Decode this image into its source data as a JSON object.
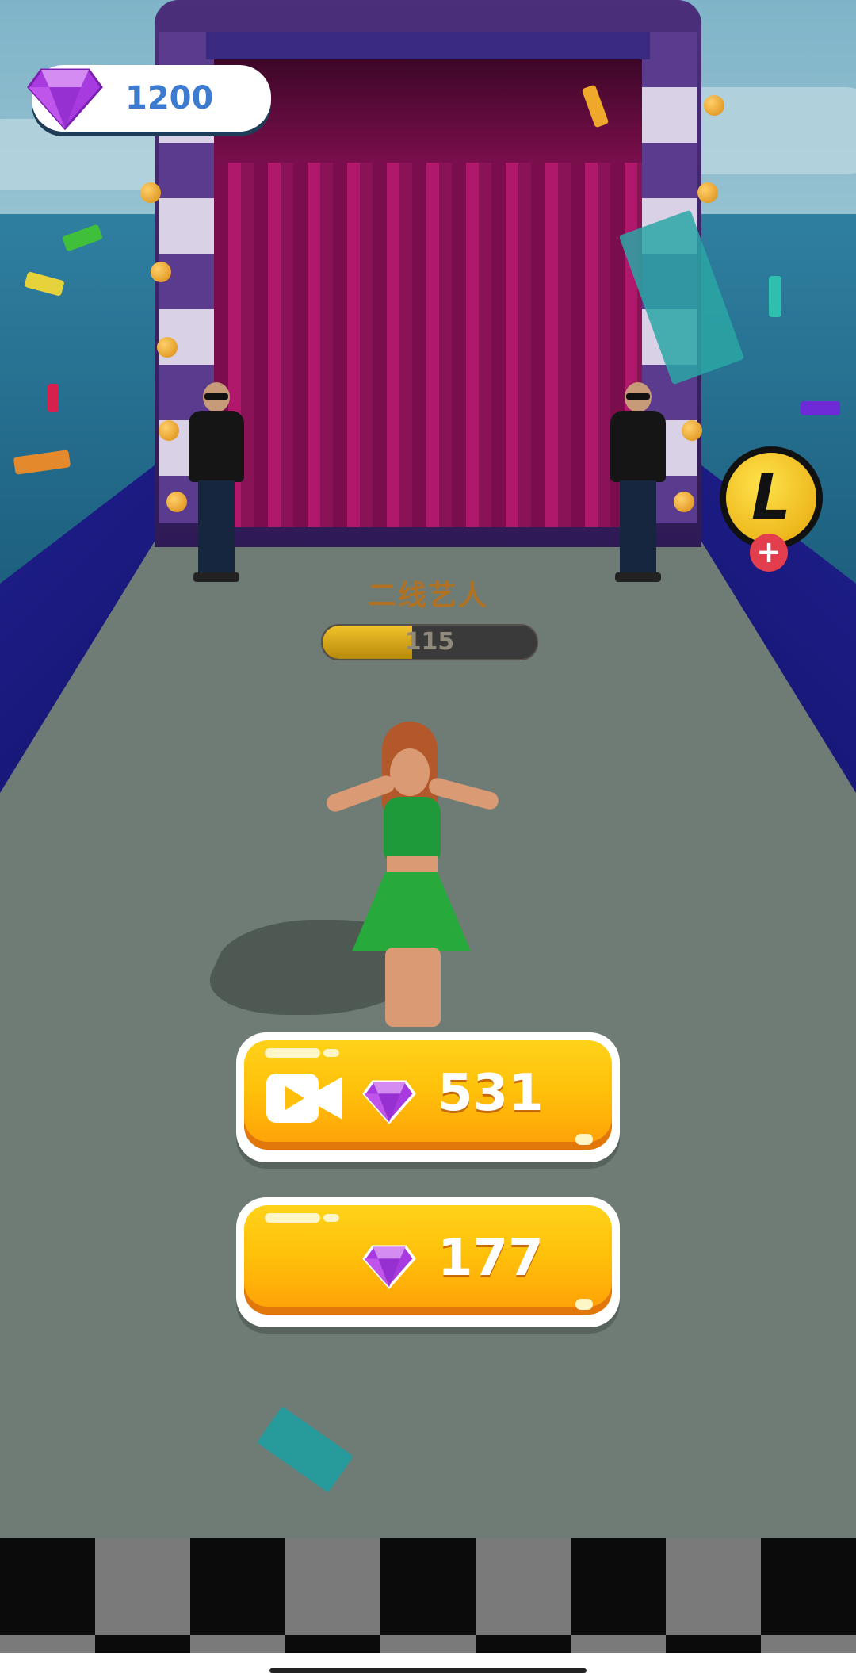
{
  "hud": {
    "gems": "1200",
    "gem_icon": "purple-diamond-icon",
    "level_coin_letter": "L",
    "level_coin_plus": "+"
  },
  "stage": {
    "title": "二线艺人",
    "progress_value": "115",
    "progress_fraction": 0.42
  },
  "buttons": {
    "video_reward_value": "531",
    "video_icon": "video-camera-icon",
    "gem_reward_value": "177"
  },
  "colors": {
    "button_yellow": "#ffc10a",
    "gem_purple": "#9b35d6",
    "gem_text_blue": "#3d7bd1"
  }
}
